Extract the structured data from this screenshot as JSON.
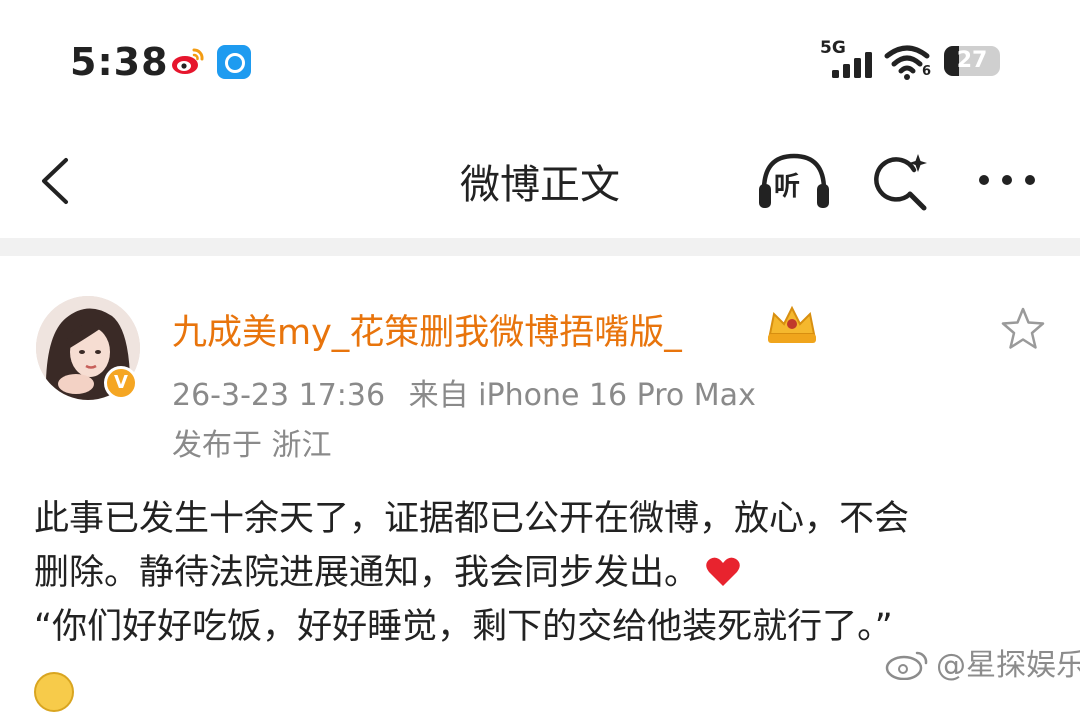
{
  "status_bar": {
    "time": "5:38",
    "network": "5G",
    "wifi_sub": "6",
    "battery_level": "27"
  },
  "nav": {
    "title": "微博正文",
    "listen_label": "听",
    "icons": [
      "back-icon",
      "listen-headphones-icon",
      "ai-search-icon",
      "more-icon"
    ]
  },
  "post": {
    "author": "九成美my_花策删我微博捂嘴版_",
    "time": "26-3-23 17:36",
    "source": "来自 iPhone 16 Pro Max",
    "location": "发布于 浙江",
    "lines": [
      "此事已发生十余天了，证据都已公开在微博，放心，不会",
      "删除。静待法院进展通知，我会同步发出。",
      "“你们好好吃饭，好好睡觉，剩下的交给他装死就行了。”"
    ]
  },
  "watermark": "@星探娱乐",
  "colors": {
    "username": "#e8740c",
    "meta": "#8a8a8a",
    "divider": "#f1f1f1"
  }
}
